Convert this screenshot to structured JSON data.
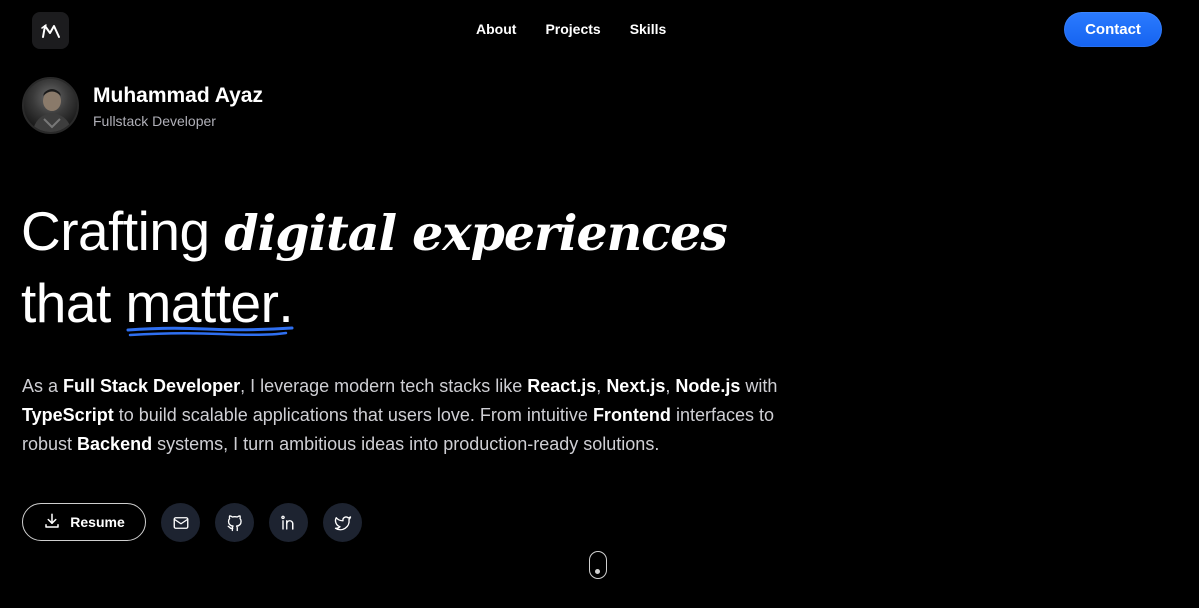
{
  "header": {
    "logo_icon": "m-logo-icon",
    "nav": [
      {
        "label": "About"
      },
      {
        "label": "Projects"
      },
      {
        "label": "Skills"
      }
    ],
    "contact_label": "Contact",
    "accent_color": "#1f6bff"
  },
  "profile": {
    "name": "Muhammad Ayaz",
    "role": "Fullstack Developer",
    "avatar_icon": "avatar-photo"
  },
  "hero": {
    "line1_plain": "Crafting ",
    "line1_emphasis": "digital experiences",
    "line2_plain": "that ",
    "line2_highlight": "matter",
    "line2_end": "."
  },
  "description": {
    "t1": "As a ",
    "b1": "Full Stack Developer",
    "t2": ", I leverage modern tech stacks like ",
    "b2": "React.js",
    "t3": ", ",
    "b3": "Next.js",
    "t4": ", ",
    "b4": "Node.js",
    "t5": " with ",
    "b5": "TypeScript",
    "t6": " to build scalable applications that users love. From intuitive ",
    "b6": "Frontend",
    "t7": " interfaces to robust ",
    "b7": "Backend",
    "t8": " systems, I turn ambitious ideas into production-ready solutions."
  },
  "actions": {
    "resume_label": "Resume",
    "resume_icon": "download-icon",
    "socials": [
      {
        "icon": "mail-icon"
      },
      {
        "icon": "github-icon"
      },
      {
        "icon": "linkedin-icon"
      },
      {
        "icon": "twitter-icon"
      }
    ]
  }
}
